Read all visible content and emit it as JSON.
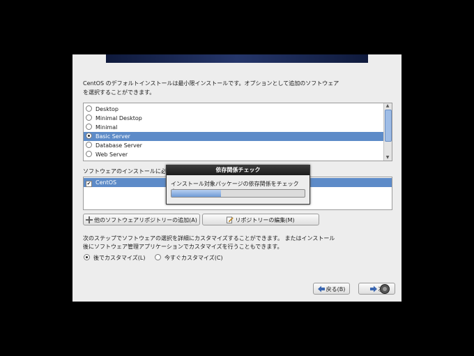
{
  "intro_text": "CentOS のデフォルトインストールは最小限インストールです。オプションとして追加のソフトウェア\nを選択することができます。",
  "installation_types": [
    {
      "label": "Desktop",
      "selected": false
    },
    {
      "label": "Minimal Desktop",
      "selected": false
    },
    {
      "label": "Minimal",
      "selected": false
    },
    {
      "label": "Basic Server",
      "selected": true
    },
    {
      "label": "Database Server",
      "selected": false
    },
    {
      "label": "Web Server",
      "selected": false
    }
  ],
  "repo_label": "ソフトウェアのインストールに必要",
  "repositories": [
    {
      "label": "CentOS",
      "checked": true
    }
  ],
  "buttons": {
    "add_repo": "他のソフトウェアリポジトリーの追加(A)",
    "edit_repo": "リポジトリーの編集(M)",
    "back": "戻る(B)",
    "next": "次"
  },
  "customize_text": "次のステップでソフトウェアの選択を詳細にカスタマイズすることができます。 またはインストール\n後にソフトウェア管理アプリケーションでカスタマイズを行うこともできます。",
  "customize_options": {
    "later": "後でカスタマイズ(L)",
    "now": "今すぐカスタマイズ(C)",
    "selected": "later"
  },
  "dialog": {
    "title": "依存関係チェック",
    "message": "インストール対象パッケージの依存関係をチェック中。",
    "progress": 0.37
  },
  "colors": {
    "selection": "#5d8bc8",
    "background": "#000000",
    "window": "#ededed"
  }
}
